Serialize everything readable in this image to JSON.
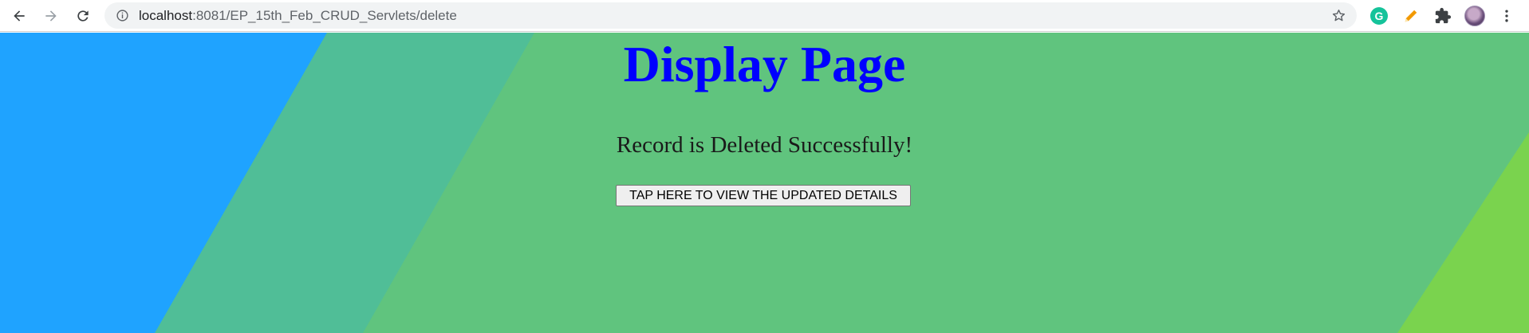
{
  "browser": {
    "url_host": "localhost",
    "url_path": ":8081/EP_15th_Feb_CRUD_Servlets/delete",
    "extensions": [
      "grammarly-icon",
      "pencil-icon",
      "puzzle-icon"
    ],
    "grammarly_letter": "G"
  },
  "page": {
    "title": "Display Page",
    "message": "Record is Deleted Successfully!",
    "button_label": "TAP HERE TO VIEW THE UPDATED DETAILS"
  },
  "colors": {
    "title": "#0000ff",
    "bg_blue": "#1fa3ff",
    "bg_teal": "#50be97",
    "bg_green": "#60c47e",
    "bg_lime": "#7ad34e"
  }
}
